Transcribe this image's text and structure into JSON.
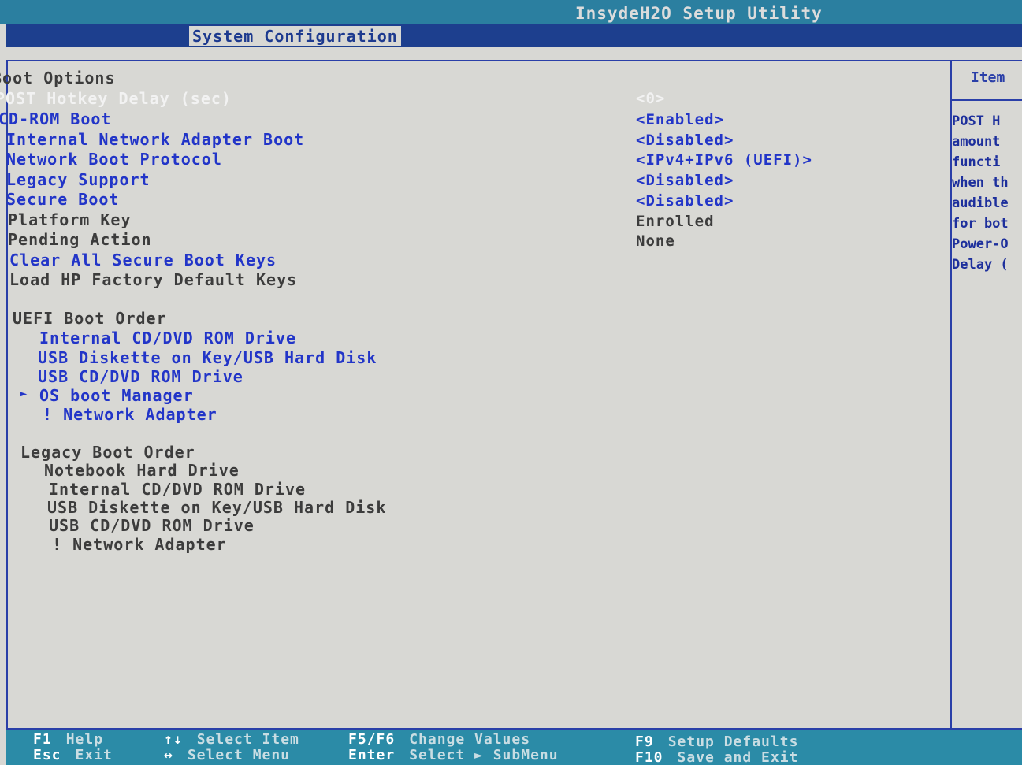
{
  "window": {
    "title": "InsydeH2O Setup Utility"
  },
  "tabs": {
    "active": "System Configuration"
  },
  "boot_options": {
    "heading": "Boot Options",
    "items": [
      {
        "label": "POST Hotkey Delay (sec)",
        "value": "<0>"
      },
      {
        "label": "CD-ROM Boot",
        "value": "<Enabled>"
      },
      {
        "label": "Internal Network Adapter Boot",
        "value": "<Disabled>"
      },
      {
        "label": "Network Boot Protocol",
        "value": "<IPv4+IPv6 (UEFI)>"
      },
      {
        "label": "Legacy Support",
        "value": "<Disabled>"
      },
      {
        "label": "Secure Boot",
        "value": "<Disabled>"
      },
      {
        "label": "Platform Key",
        "value": "Enrolled"
      },
      {
        "label": "Pending Action",
        "value": "None"
      },
      {
        "label": "Clear All Secure Boot Keys"
      },
      {
        "label": "Load HP Factory Default Keys"
      }
    ]
  },
  "uefi_boot_order": {
    "heading": "UEFI Boot Order",
    "items": [
      "Internal CD/DVD ROM Drive",
      "USB Diskette on Key/USB Hard Disk",
      "USB CD/DVD ROM Drive",
      "OS boot Manager",
      "! Network Adapter"
    ]
  },
  "legacy_boot_order": {
    "heading": "Legacy Boot Order",
    "items": [
      "Notebook Hard Drive",
      "Internal CD/DVD ROM Drive",
      "USB Diskette on Key/USB Hard Disk",
      "USB CD/DVD ROM Drive",
      "! Network Adapter"
    ]
  },
  "help_panel": {
    "title": "Item",
    "lines": [
      "POST H",
      "amount",
      "functi",
      "when th",
      "audible",
      "for bot",
      "Power-O",
      "Delay ("
    ]
  },
  "footer": {
    "f1_key": "F1",
    "f1_desc": "Help",
    "esc_key": "Esc",
    "esc_desc": "Exit",
    "updown_key": "↑↓",
    "updown_desc": "Select Item",
    "leftright_key": "↔",
    "leftright_desc": "Select Menu",
    "f5f6_key": "F5/F6",
    "f5f6_desc": "Change Values",
    "enter_key": "Enter",
    "enter_desc": "Select ► SubMenu",
    "f9_key": "F9",
    "f9_desc": "Setup Defaults",
    "f10_key": "F10",
    "f10_desc": "Save and Exit"
  },
  "colors": {
    "item_blue": "#2235c8",
    "tab_bar": "#1d3f8e",
    "footer_bar": "#2b8ba7",
    "background": "#d8d8d4"
  }
}
